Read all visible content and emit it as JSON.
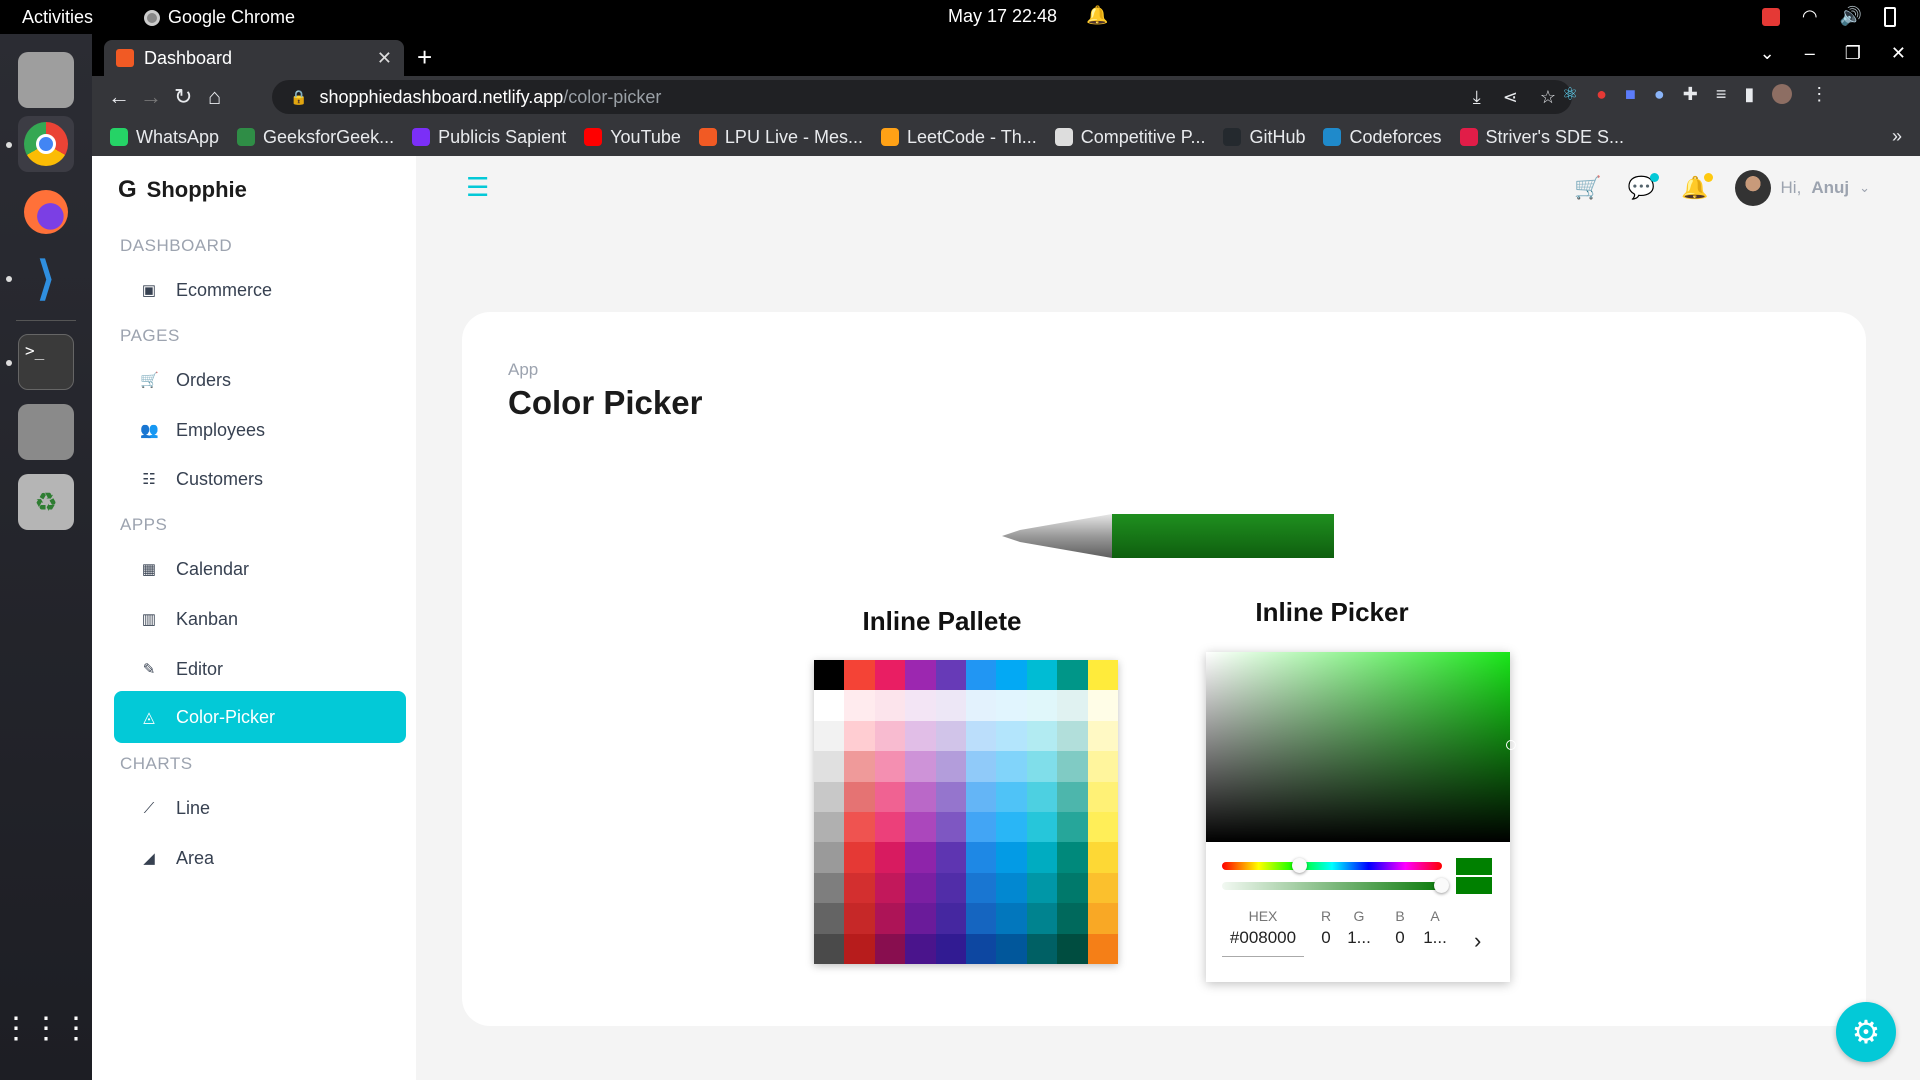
{
  "os": {
    "activities": "Activities",
    "app_name": "Google Chrome",
    "clock": "May 17  22:48"
  },
  "browser": {
    "tab_title": "Dashboard",
    "url_host": "shopphiedashboard.netlify.app",
    "url_path": "/color-picker",
    "bookmarks": [
      {
        "label": "WhatsApp",
        "color": "#25d366"
      },
      {
        "label": "GeeksforGeek...",
        "color": "#2f8d46"
      },
      {
        "label": "Publicis Sapient",
        "color": "#7b2ff7"
      },
      {
        "label": "YouTube",
        "color": "#ff0000"
      },
      {
        "label": "LPU Live - Mes...",
        "color": "#f15a24"
      },
      {
        "label": "LeetCode - Th...",
        "color": "#ffa116"
      },
      {
        "label": "Competitive P...",
        "color": "#dddddd"
      },
      {
        "label": "GitHub",
        "color": "#24292e"
      },
      {
        "label": "Codeforces",
        "color": "#1f8acb"
      },
      {
        "label": "Striver's SDE S...",
        "color": "#e11d48"
      }
    ]
  },
  "sidebar": {
    "logo": "Shopphie",
    "sections": [
      {
        "title": "DASHBOARD",
        "items": [
          {
            "label": "Ecommerce",
            "icon": "bag-icon"
          }
        ]
      },
      {
        "title": "PAGES",
        "items": [
          {
            "label": "Orders",
            "icon": "cart-icon"
          },
          {
            "label": "Employees",
            "icon": "people-icon"
          },
          {
            "label": "Customers",
            "icon": "customers-icon"
          }
        ]
      },
      {
        "title": "APPS",
        "items": [
          {
            "label": "Calendar",
            "icon": "calendar-icon"
          },
          {
            "label": "Kanban",
            "icon": "kanban-icon"
          },
          {
            "label": "Editor",
            "icon": "editor-icon"
          },
          {
            "label": "Color-Picker",
            "icon": "color-picker-icon",
            "active": true
          }
        ]
      },
      {
        "title": "CHARTS",
        "items": [
          {
            "label": "Line",
            "icon": "line-chart-icon"
          },
          {
            "label": "Area",
            "icon": "area-chart-icon"
          }
        ]
      }
    ]
  },
  "header": {
    "greeting": "Hi,",
    "user_name": "Anuj",
    "accent": "#03c9d7"
  },
  "main": {
    "breadcrumb": "App",
    "title": "Color Picker",
    "palette_title": "Inline Pallete",
    "picker_title": "Inline Picker",
    "selected_color": "#008000",
    "fields": {
      "hex_label": "HEX",
      "hex_value": "#008000",
      "r_label": "R",
      "r_value": "0",
      "g_label": "G",
      "g_value": "1...",
      "b_label": "B",
      "b_value": "0",
      "a_label": "A",
      "a_value": "1..."
    },
    "palette_columns": [
      [
        "#000000",
        "#ffffff",
        "#f2f2f2",
        "#e0e0e0",
        "#c8c8c8",
        "#b0b0b0",
        "#9a9a9a",
        "#7e7e7e",
        "#646464",
        "#4a4a4a"
      ],
      [
        "#f44336",
        "#ffebee",
        "#ffcdd2",
        "#ef9a9a",
        "#e57373",
        "#ef5350",
        "#e53935",
        "#d32f2f",
        "#c62828",
        "#b71c1c"
      ],
      [
        "#e91e63",
        "#fce4ec",
        "#f8bbd0",
        "#f48fb1",
        "#f06292",
        "#ec407a",
        "#d81b60",
        "#c2185b",
        "#ad1457",
        "#880e4f"
      ],
      [
        "#9c27b0",
        "#f3e5f5",
        "#e1bee7",
        "#ce93d8",
        "#ba68c8",
        "#ab47bc",
        "#8e24aa",
        "#7b1fa2",
        "#6a1b9a",
        "#4a148c"
      ],
      [
        "#673ab7",
        "#ede7f6",
        "#d1c4e9",
        "#b39ddb",
        "#9575cd",
        "#7e57c2",
        "#5e35b1",
        "#512da8",
        "#4527a0",
        "#311b92"
      ],
      [
        "#2196f3",
        "#e3f2fd",
        "#bbdefb",
        "#90caf9",
        "#64b5f6",
        "#42a5f5",
        "#1e88e5",
        "#1976d2",
        "#1565c0",
        "#0d47a1"
      ],
      [
        "#03a9f4",
        "#e1f5fe",
        "#b3e5fc",
        "#81d4fa",
        "#4fc3f7",
        "#29b6f6",
        "#039be5",
        "#0288d1",
        "#0277bd",
        "#01579b"
      ],
      [
        "#00bcd4",
        "#e0f7fa",
        "#b2ebf2",
        "#80deea",
        "#4dd0e1",
        "#26c6da",
        "#00acc1",
        "#0097a7",
        "#00838f",
        "#006064"
      ],
      [
        "#009688",
        "#e0f2f1",
        "#b2dfdb",
        "#80cbc4",
        "#4db6ac",
        "#26a69a",
        "#00897b",
        "#00796b",
        "#00695c",
        "#004d40"
      ],
      [
        "#ffeb3b",
        "#fffde7",
        "#fff9c4",
        "#fff59d",
        "#fff176",
        "#ffee58",
        "#fdd835",
        "#fbc02d",
        "#f9a825",
        "#f57f17"
      ]
    ]
  }
}
